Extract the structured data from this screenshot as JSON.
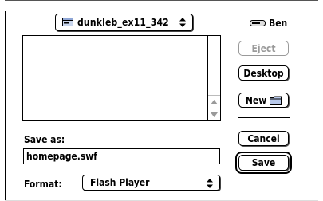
{
  "folder_popup": {
    "label": "dunkleb_ex11_342",
    "icon": "hard-disk-icon"
  },
  "user": {
    "label": "Ben",
    "icon": "drive-icon"
  },
  "buttons": {
    "eject": "Eject",
    "desktop": "Desktop",
    "new": "New",
    "cancel": "Cancel",
    "save": "Save"
  },
  "save_as": {
    "label": "Save as:",
    "value": "homepage.swf"
  },
  "format": {
    "label": "Format:",
    "selected": "Flash Player"
  },
  "file_list": {
    "items": []
  },
  "colors": {
    "disabled_text": "#9a9a9a",
    "border": "#000000",
    "background": "#ffffff"
  }
}
